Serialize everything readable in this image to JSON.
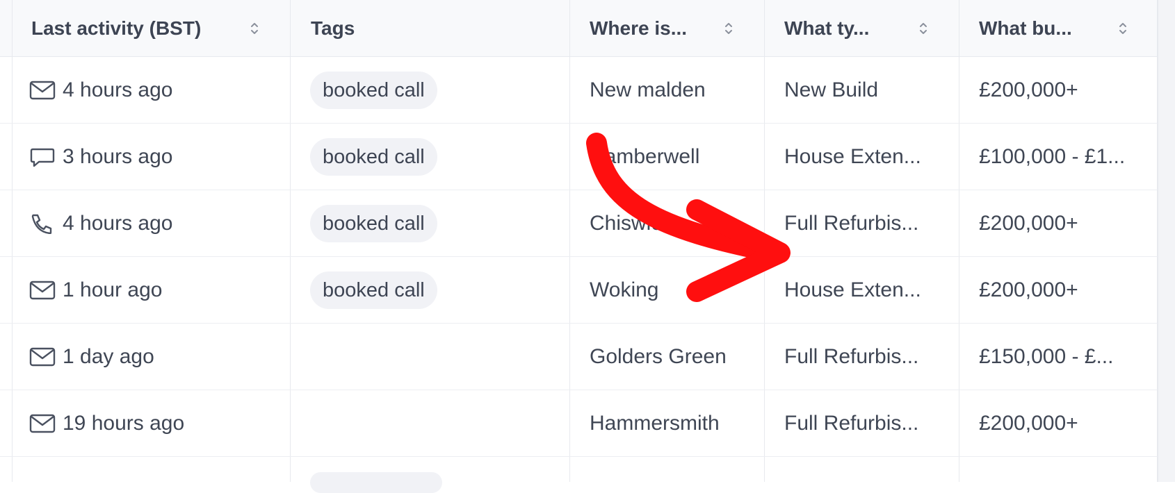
{
  "columns": {
    "last_activity": "Last activity (BST)",
    "tags": "Tags",
    "where": "Where is...",
    "what_type": "What ty...",
    "what_budget": "What bu..."
  },
  "rows": [
    {
      "activity_icon": "mail-icon",
      "activity": "4 hours ago",
      "tag": "booked call",
      "where": "New malden",
      "what_type": "New Build",
      "budget": "£200,000+"
    },
    {
      "activity_icon": "chat-icon",
      "activity": "3 hours ago",
      "tag": "booked call",
      "where": "Camberwell",
      "what_type": "House Exten...",
      "budget": "£100,000 - £1..."
    },
    {
      "activity_icon": "phone-icon",
      "activity": "4 hours ago",
      "tag": "booked call",
      "where": "Chiswick",
      "what_type": "Full Refurbis...",
      "budget": "£200,000+"
    },
    {
      "activity_icon": "mail-icon",
      "activity": "1 hour ago",
      "tag": "booked call",
      "where": "Woking",
      "what_type": "House Exten...",
      "budget": "£200,000+"
    },
    {
      "activity_icon": "mail-icon",
      "activity": "1 day ago",
      "tag": "",
      "where": "Golders Green",
      "what_type": "Full Refurbis...",
      "budget": "£150,000 - £..."
    },
    {
      "activity_icon": "mail-icon",
      "activity": "19 hours ago",
      "tag": "",
      "where": "Hammersmith",
      "what_type": "Full Refurbis...",
      "budget": "£200,000+"
    }
  ],
  "annotation": {
    "color": "#ff0f0f",
    "icon": "red-arrow-annotation"
  }
}
